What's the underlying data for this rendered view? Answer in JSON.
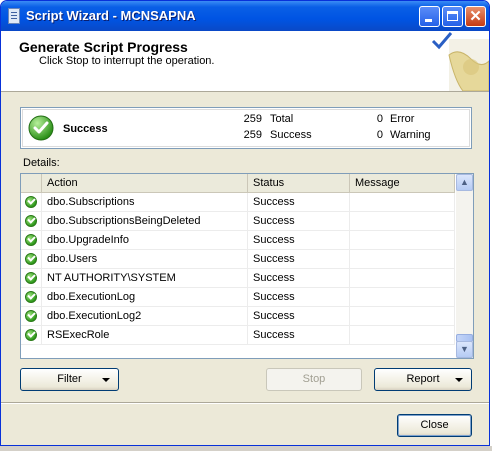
{
  "window": {
    "title": "Script Wizard - MCNSAPNA"
  },
  "header": {
    "title": "Generate Script Progress",
    "subtitle": "Click Stop to interrupt the operation."
  },
  "status": {
    "label": "Success",
    "total_count": "259",
    "total_label": "Total",
    "success_count": "259",
    "success_label": "Success",
    "error_count": "0",
    "error_label": "Error",
    "warning_count": "0",
    "warning_label": "Warning"
  },
  "details": {
    "label": "Details:",
    "columns": [
      "Action",
      "Status",
      "Message"
    ],
    "rows": [
      {
        "action": "dbo.Subscriptions",
        "status": "Success",
        "message": ""
      },
      {
        "action": "dbo.SubscriptionsBeingDeleted",
        "status": "Success",
        "message": ""
      },
      {
        "action": "dbo.UpgradeInfo",
        "status": "Success",
        "message": ""
      },
      {
        "action": "dbo.Users",
        "status": "Success",
        "message": ""
      },
      {
        "action": "NT AUTHORITY\\SYSTEM",
        "status": "Success",
        "message": ""
      },
      {
        "action": "dbo.ExecutionLog",
        "status": "Success",
        "message": ""
      },
      {
        "action": "dbo.ExecutionLog2",
        "status": "Success",
        "message": ""
      },
      {
        "action": "RSExecRole",
        "status": "Success",
        "message": ""
      }
    ]
  },
  "buttons": {
    "filter": "Filter",
    "stop": "Stop",
    "report": "Report",
    "close": "Close"
  },
  "colors": {
    "titlebar": "#0054e3",
    "dialog": "#ece9d8",
    "success_green": "#2f9a1c"
  }
}
